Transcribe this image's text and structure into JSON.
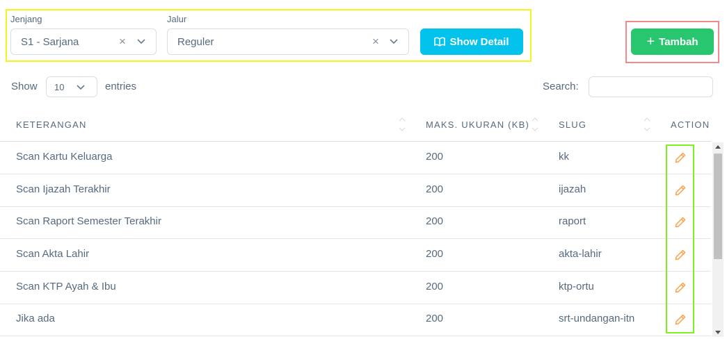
{
  "filters": {
    "jenjang": {
      "label": "Jenjang",
      "value": "S1 - Sarjana",
      "clear": "×"
    },
    "jalur": {
      "label": "Jalur",
      "value": "Reguler",
      "clear": "×"
    },
    "show_detail_label": "Show Detail"
  },
  "add_button": {
    "icon": "+",
    "label": "Tambah"
  },
  "table_controls": {
    "show_label": "Show",
    "page_length": "10",
    "entries_label": "entries",
    "search_label": "Search:",
    "search_value": ""
  },
  "table": {
    "headers": [
      "KETERANGAN",
      "MAKS. UKURAN (KB)",
      "SLUG",
      "ACTION"
    ],
    "rows": [
      {
        "keterangan": "Scan Kartu Keluarga",
        "maks_ukuran": "200",
        "slug": "kk"
      },
      {
        "keterangan": "Scan Ijazah Terakhir",
        "maks_ukuran": "200",
        "slug": "ijazah"
      },
      {
        "keterangan": "Scan Raport Semester Terakhir",
        "maks_ukuran": "200",
        "slug": "raport"
      },
      {
        "keterangan": "Scan Akta Lahir",
        "maks_ukuran": "200",
        "slug": "akta-lahir"
      },
      {
        "keterangan": "Scan KTP Ayah & Ibu",
        "maks_ukuran": "200",
        "slug": "ktp-ortu"
      },
      {
        "keterangan": "Jika ada",
        "maks_ukuran": "200",
        "slug": "srt-undangan-itn"
      }
    ],
    "action_icon": "pencil-icon"
  },
  "colors": {
    "info": "#03c3ec",
    "success": "#28c76f",
    "edit_icon": "#ff9f43",
    "highlight_yellow": "#f4f41a",
    "highlight_red": "#f08a8a",
    "highlight_green": "#7ef01f"
  }
}
